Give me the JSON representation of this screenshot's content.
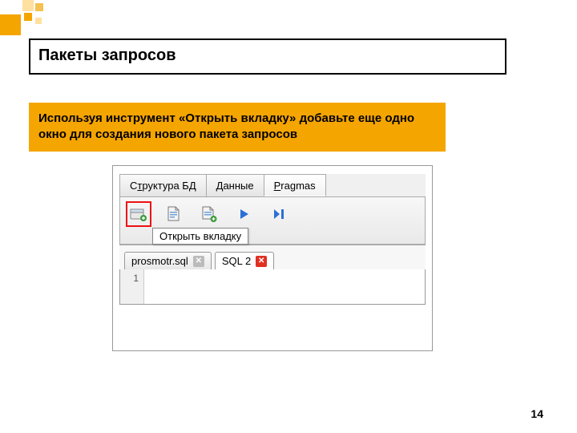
{
  "chapter_title": "Пакеты запросов",
  "instruction": "Используя инструмент «Открыть вкладку» добавьте еще одно окно для создания нового пакета запросов",
  "page_number": "14",
  "app": {
    "tabs": {
      "structure_prefix": "С",
      "structure_hot": "т",
      "structure_suffix": "руктура БД",
      "data_hot": "Д",
      "data_suffix": "анные",
      "pragmas_hot": "P",
      "pragmas_suffix": "ragmas"
    },
    "tooltip": "Открыть вкладку",
    "file_tabs": {
      "file1": "prosmotr.sql",
      "file2": "SQL 2"
    },
    "editor_line": "1"
  }
}
